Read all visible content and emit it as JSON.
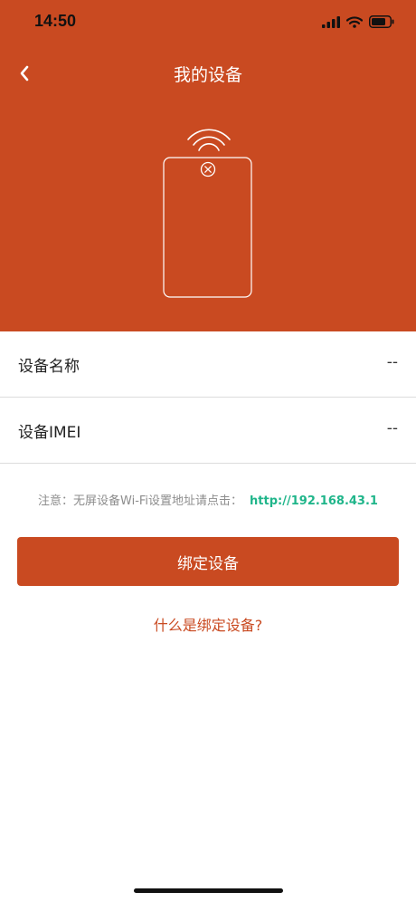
{
  "status_bar": {
    "time": "14:50",
    "icons": [
      "signal-icon",
      "wifi-icon",
      "battery-icon"
    ]
  },
  "nav": {
    "title": "我的设备",
    "back_icon": "chevron-left-icon"
  },
  "illustration": {
    "icons": [
      "wifi-waves-icon",
      "phone-outline-icon",
      "close-circle-icon"
    ]
  },
  "device_info": {
    "rows": [
      {
        "label": "设备名称",
        "value": "--"
      },
      {
        "label": "设备IMEI",
        "value": "--"
      }
    ]
  },
  "notice": {
    "text": "注意：无屏设备Wi-Fi设置地址请点击：",
    "link": "http://192.168.43.1"
  },
  "actions": {
    "bind_label": "绑定设备",
    "help_label": "什么是绑定设备?"
  },
  "colors": {
    "brand": "#c94a21",
    "link_green": "#1fb58a",
    "text_muted": "#8d8d8d"
  }
}
